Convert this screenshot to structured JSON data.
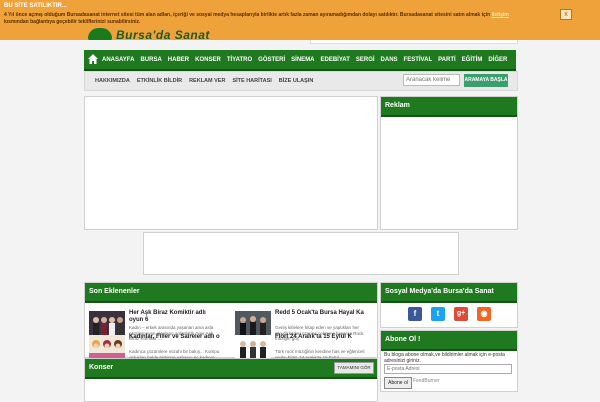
{
  "banner": {
    "title": "BU SİTE SATILIKTIR...",
    "text_before": "4 Yıl önce açmış olduğum Bursadasanat internet sitesi tüm alan adları, içeriği ve sosyal medya hesaplarıyla birlikte artık fazla zaman ayıramadığımdan dolayı satılıktır. Bursadasanat sitesini satın almak için",
    "link": "iletişim",
    "text_after": "kısmından bağlantıya geçebilir tekliflerinizi sunabilirsiniz.",
    "close": "x"
  },
  "logo": {
    "text": "Bursa'da Sanat"
  },
  "nav": {
    "items": [
      "ANASAYFA",
      "BURSA",
      "HABER",
      "KONSER",
      "TİYATRO",
      "GÖSTERİ",
      "SİNEMA",
      "EDEBİYAT",
      "SERGİ",
      "DANS",
      "FESTİVAL",
      "PARTİ",
      "EĞİTİM",
      "DİĞER"
    ]
  },
  "subnav": {
    "items": [
      "HAKKIMIZDA",
      "ETKİNLİK BİLDİR",
      "REKLAM VER",
      "SİTE HARİTASI",
      "BİZE ULAŞIN"
    ],
    "search_placeholder": "Aranacak kelime",
    "search_button": "ARAMAYA BAŞLA"
  },
  "reklam": {
    "title": "Reklam"
  },
  "son_eklenenler": {
    "title": "Son Eklenenler",
    "posts": [
      {
        "title": "Her Aşk Biraz Komiktir adlı oyun 6",
        "desc": "Kadın – erkek arasında yaşanan ama asla çözülemeyen olayların anlatıldığı \"Her Aşk Biraz Komiktir\"..."
      },
      {
        "title": "Redd 5 Ocak'ta Bursa Hayal Ka",
        "desc": "Geniş kitlelere hitap eden ve yaptıkları her işle dikkatleri üzerine çekmeyi başaran Rock müziğin göç"
      },
      {
        "title": "Kadınlar, Filler ve Saireler adlı o",
        "desc": "Kadınca çözümlere mizahi bir bakış... Kompu oldukları halde birbirine yabancı üç kadının, komik ve"
      },
      {
        "title": "Flört 24 Aralık'ta 15 Eylül K",
        "desc": "Türk rock müziğinin kendine has ve eğlenceli grubu Flört, 24 Aralık'ta 15 Eylül Kıraathanesi'nde müz"
      }
    ]
  },
  "konser": {
    "title": "Konser",
    "button": "TAMAMINI GÖR"
  },
  "sosyal": {
    "title": "Sosyal Medya'da Bursa'da Sanat",
    "icons": [
      {
        "name": "facebook-icon",
        "glyph": "f",
        "color": "#3b5998"
      },
      {
        "name": "twitter-icon",
        "glyph": "t",
        "color": "#1da1f2"
      },
      {
        "name": "google-plus-icon",
        "glyph": "g+",
        "color": "#dd4b39"
      },
      {
        "name": "rss-icon",
        "glyph": "◉",
        "color": "#f26522"
      }
    ]
  },
  "abone": {
    "title": "Abone Ol !",
    "desc": "Bu bloga abone olmak,ve bildirimler almak için e-posta adresinizi giriniz.",
    "placeholder": "E-posta Adresi",
    "button": "Abone ol",
    "link": "FeedBurner"
  },
  "colors": {
    "nav_green": "#1f7a1f",
    "banner_orange": "#f0a23a"
  }
}
